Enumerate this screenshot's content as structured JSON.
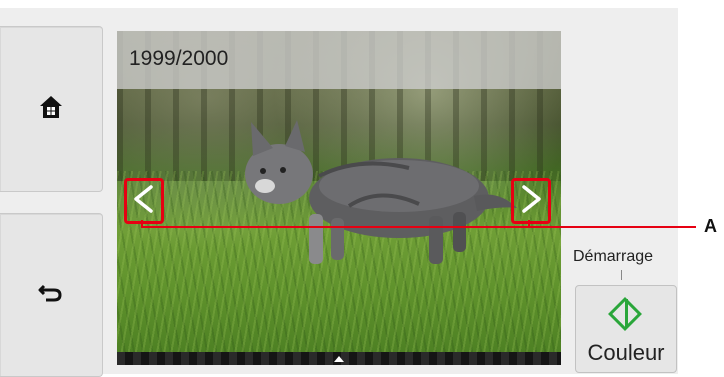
{
  "photo": {
    "counter": "1999/2000"
  },
  "navigation": {
    "home_icon": "home-icon",
    "back_icon": "back-arrow-icon",
    "prev_icon": "chevron-left-icon",
    "next_icon": "chevron-right-icon"
  },
  "callout": {
    "label": "A"
  },
  "start": {
    "caption": "Démarrage",
    "button_label": "Couleur",
    "icon": "start-diamond-icon"
  },
  "colors": {
    "highlight": "#e60012",
    "start_green": "#2aa63a"
  }
}
